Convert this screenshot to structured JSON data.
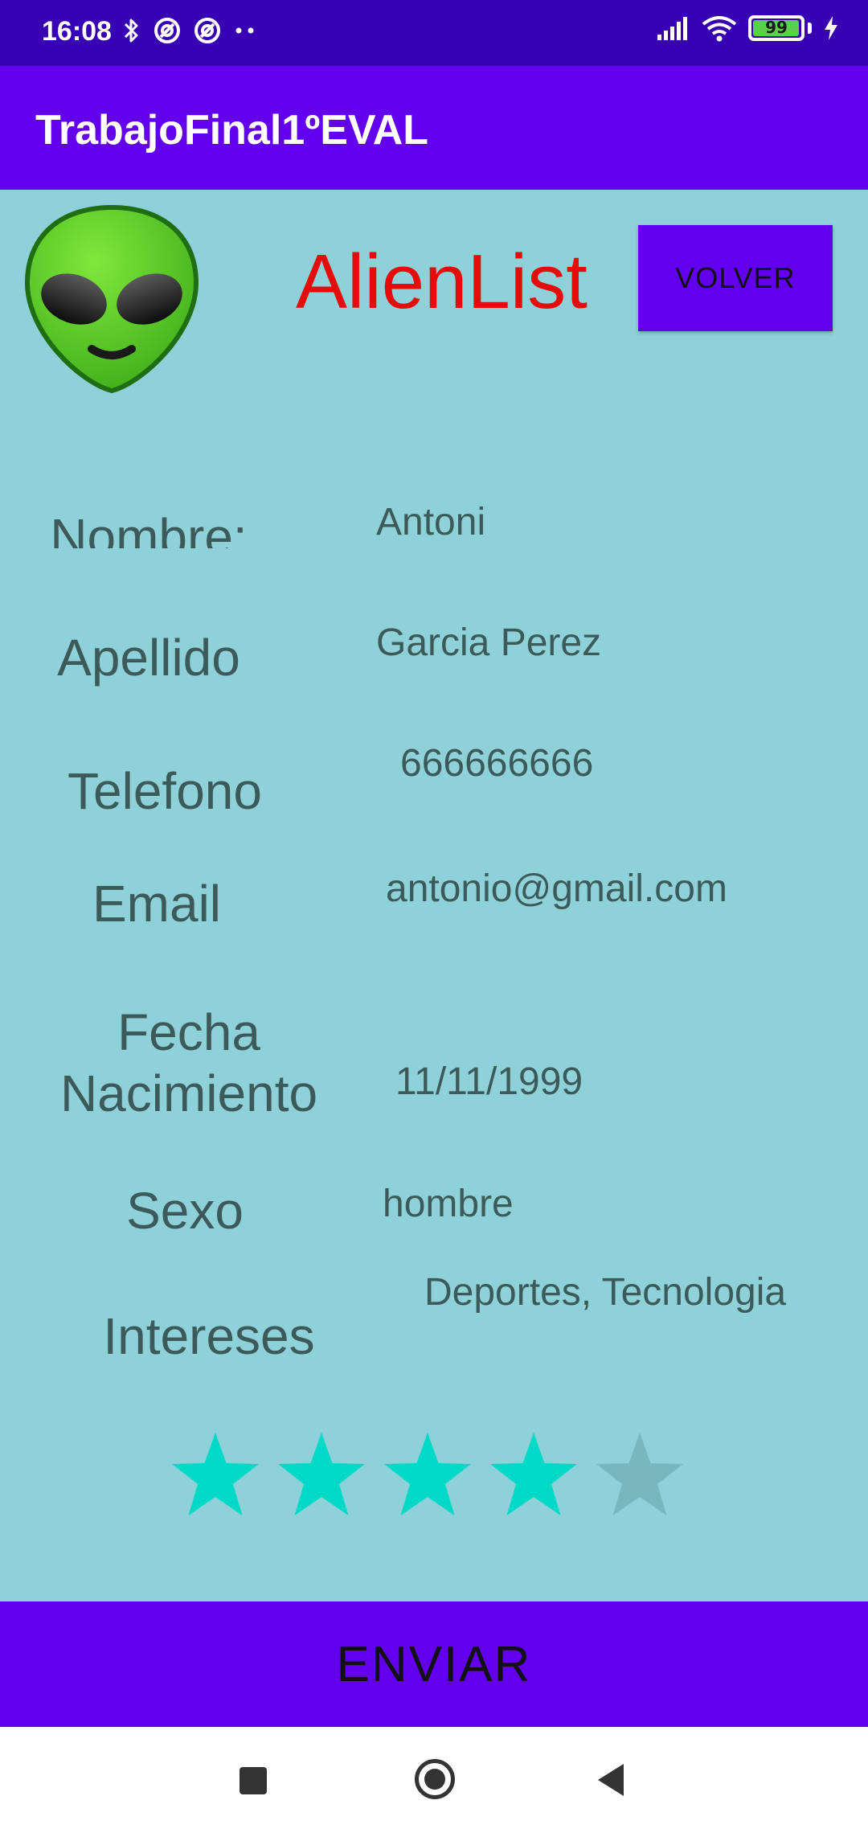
{
  "status_bar": {
    "time": "16:08",
    "battery": "99",
    "battery_level": 0.99,
    "icons_left": [
      "bluetooth-icon",
      "at-sign-icon",
      "at-sign-icon",
      "more-dots-icon"
    ],
    "icons_right": [
      "signal-icon",
      "wifi-icon",
      "battery-icon",
      "charging-icon"
    ]
  },
  "app_bar": {
    "title": "TrabajoFinal1ºEVAL"
  },
  "header": {
    "logo_icon": "alien-icon",
    "brand": "AlienList",
    "back_label": "VOLVER"
  },
  "fields": {
    "nombre": {
      "label": "Nombre:",
      "value": "Antoni"
    },
    "apellido": {
      "label": "Apellido",
      "value": "Garcia Perez"
    },
    "telefono": {
      "label": "Telefono",
      "value": "666666666"
    },
    "email": {
      "label": "Email",
      "value": "antonio@gmail.com"
    },
    "fecha_line1": "Fecha",
    "fecha_line2": "Nacimiento",
    "fecha_value": "11/11/1999",
    "sexo": {
      "label": "Sexo",
      "value": "hombre"
    },
    "intereses": {
      "label": "Intereses",
      "value": "Deportes, Tecnologia"
    }
  },
  "rating": {
    "value": 4,
    "max": 5,
    "filled_color": "#00d9c8",
    "empty_color": "#77b8bf"
  },
  "submit": {
    "label": "ENVIAR"
  },
  "colors": {
    "primary": "#6200ee",
    "status_bar": "#3700b3",
    "background": "#8ed1d8",
    "brand_red": "#e60b0b"
  },
  "nav_bar": {
    "icons": [
      "recents-icon",
      "home-icon",
      "back-icon"
    ]
  }
}
